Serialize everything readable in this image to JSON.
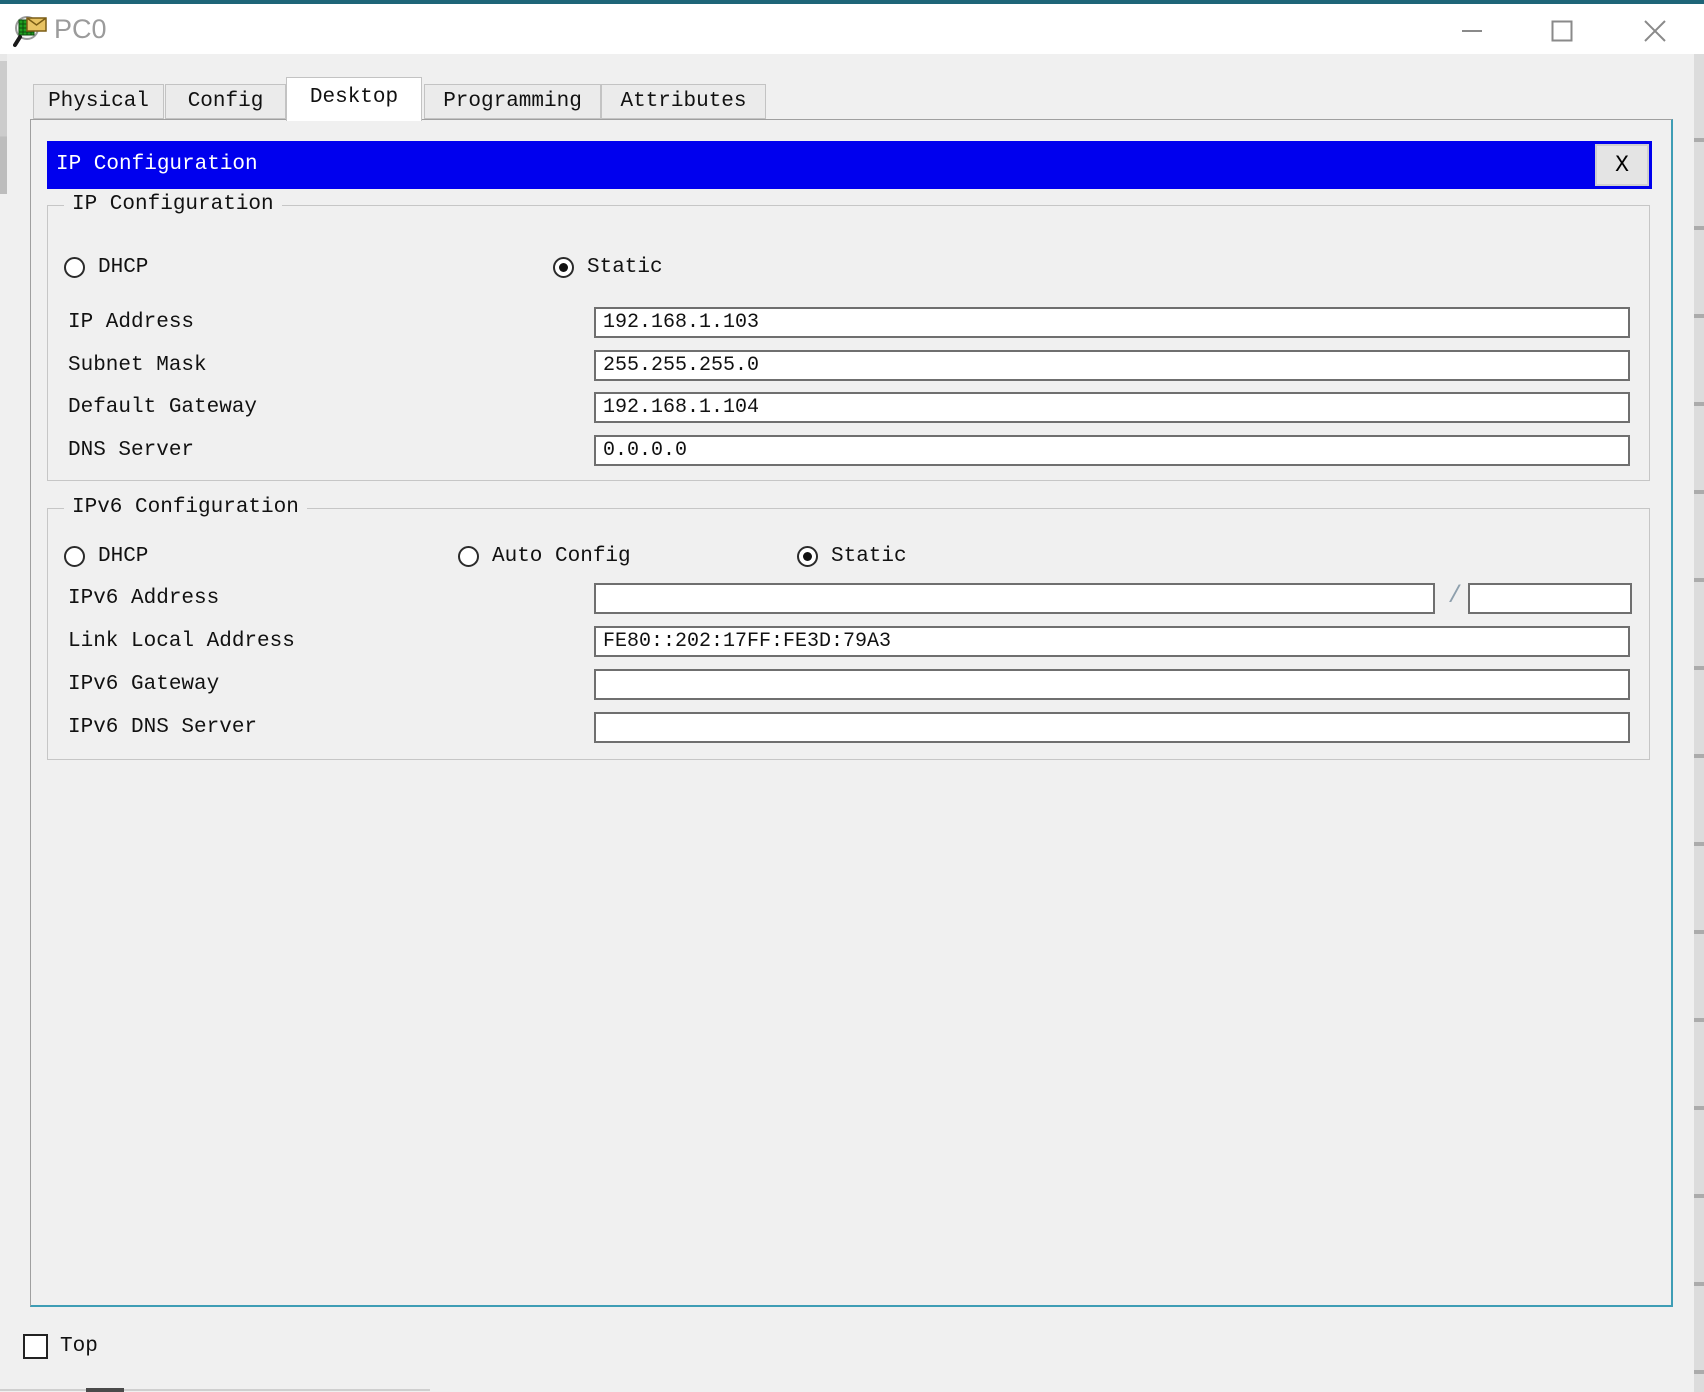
{
  "window": {
    "title": "PC0",
    "icons": {
      "app": "packet-tracer-envelope-magnifier-icon",
      "minimize": "minimize-icon",
      "maximize": "maximize-icon",
      "close": "close-icon"
    }
  },
  "tabs": {
    "items": [
      {
        "label": "Physical",
        "active": false
      },
      {
        "label": "Config",
        "active": false
      },
      {
        "label": "Desktop",
        "active": true
      },
      {
        "label": "Programming",
        "active": false
      },
      {
        "label": "Attributes",
        "active": false
      }
    ]
  },
  "app": {
    "titlebar": {
      "title": "IP Configuration",
      "close_label": "X"
    },
    "ipv4": {
      "legend": "IP Configuration",
      "radios": [
        {
          "label": "DHCP",
          "selected": false
        },
        {
          "label": "Static",
          "selected": true
        }
      ],
      "fields": [
        {
          "label": "IP Address",
          "value": "192.168.1.103"
        },
        {
          "label": "Subnet Mask",
          "value": "255.255.255.0"
        },
        {
          "label": "Default Gateway",
          "value": "192.168.1.104"
        },
        {
          "label": "DNS Server",
          "value": "0.0.0.0"
        }
      ]
    },
    "ipv6": {
      "legend": "IPv6 Configuration",
      "radios": [
        {
          "label": "DHCP",
          "selected": false
        },
        {
          "label": "Auto Config",
          "selected": false
        },
        {
          "label": "Static",
          "selected": true
        }
      ],
      "address_row": {
        "label": "IPv6 Address",
        "value": "",
        "separator": "/",
        "prefix_value": ""
      },
      "fields": [
        {
          "label": "Link Local Address",
          "value": "FE80::202:17FF:FE3D:79A3"
        },
        {
          "label": "IPv6 Gateway",
          "value": ""
        },
        {
          "label": "IPv6 DNS Server",
          "value": ""
        }
      ]
    }
  },
  "footer": {
    "checkbox_label": "Top",
    "checked": false
  },
  "colors": {
    "app_bar_blue": "#0000ee",
    "titlebar_teal": "#1e6578",
    "pane_border_teal": "#3e9db5",
    "window_bg": "#f0f0f0"
  }
}
